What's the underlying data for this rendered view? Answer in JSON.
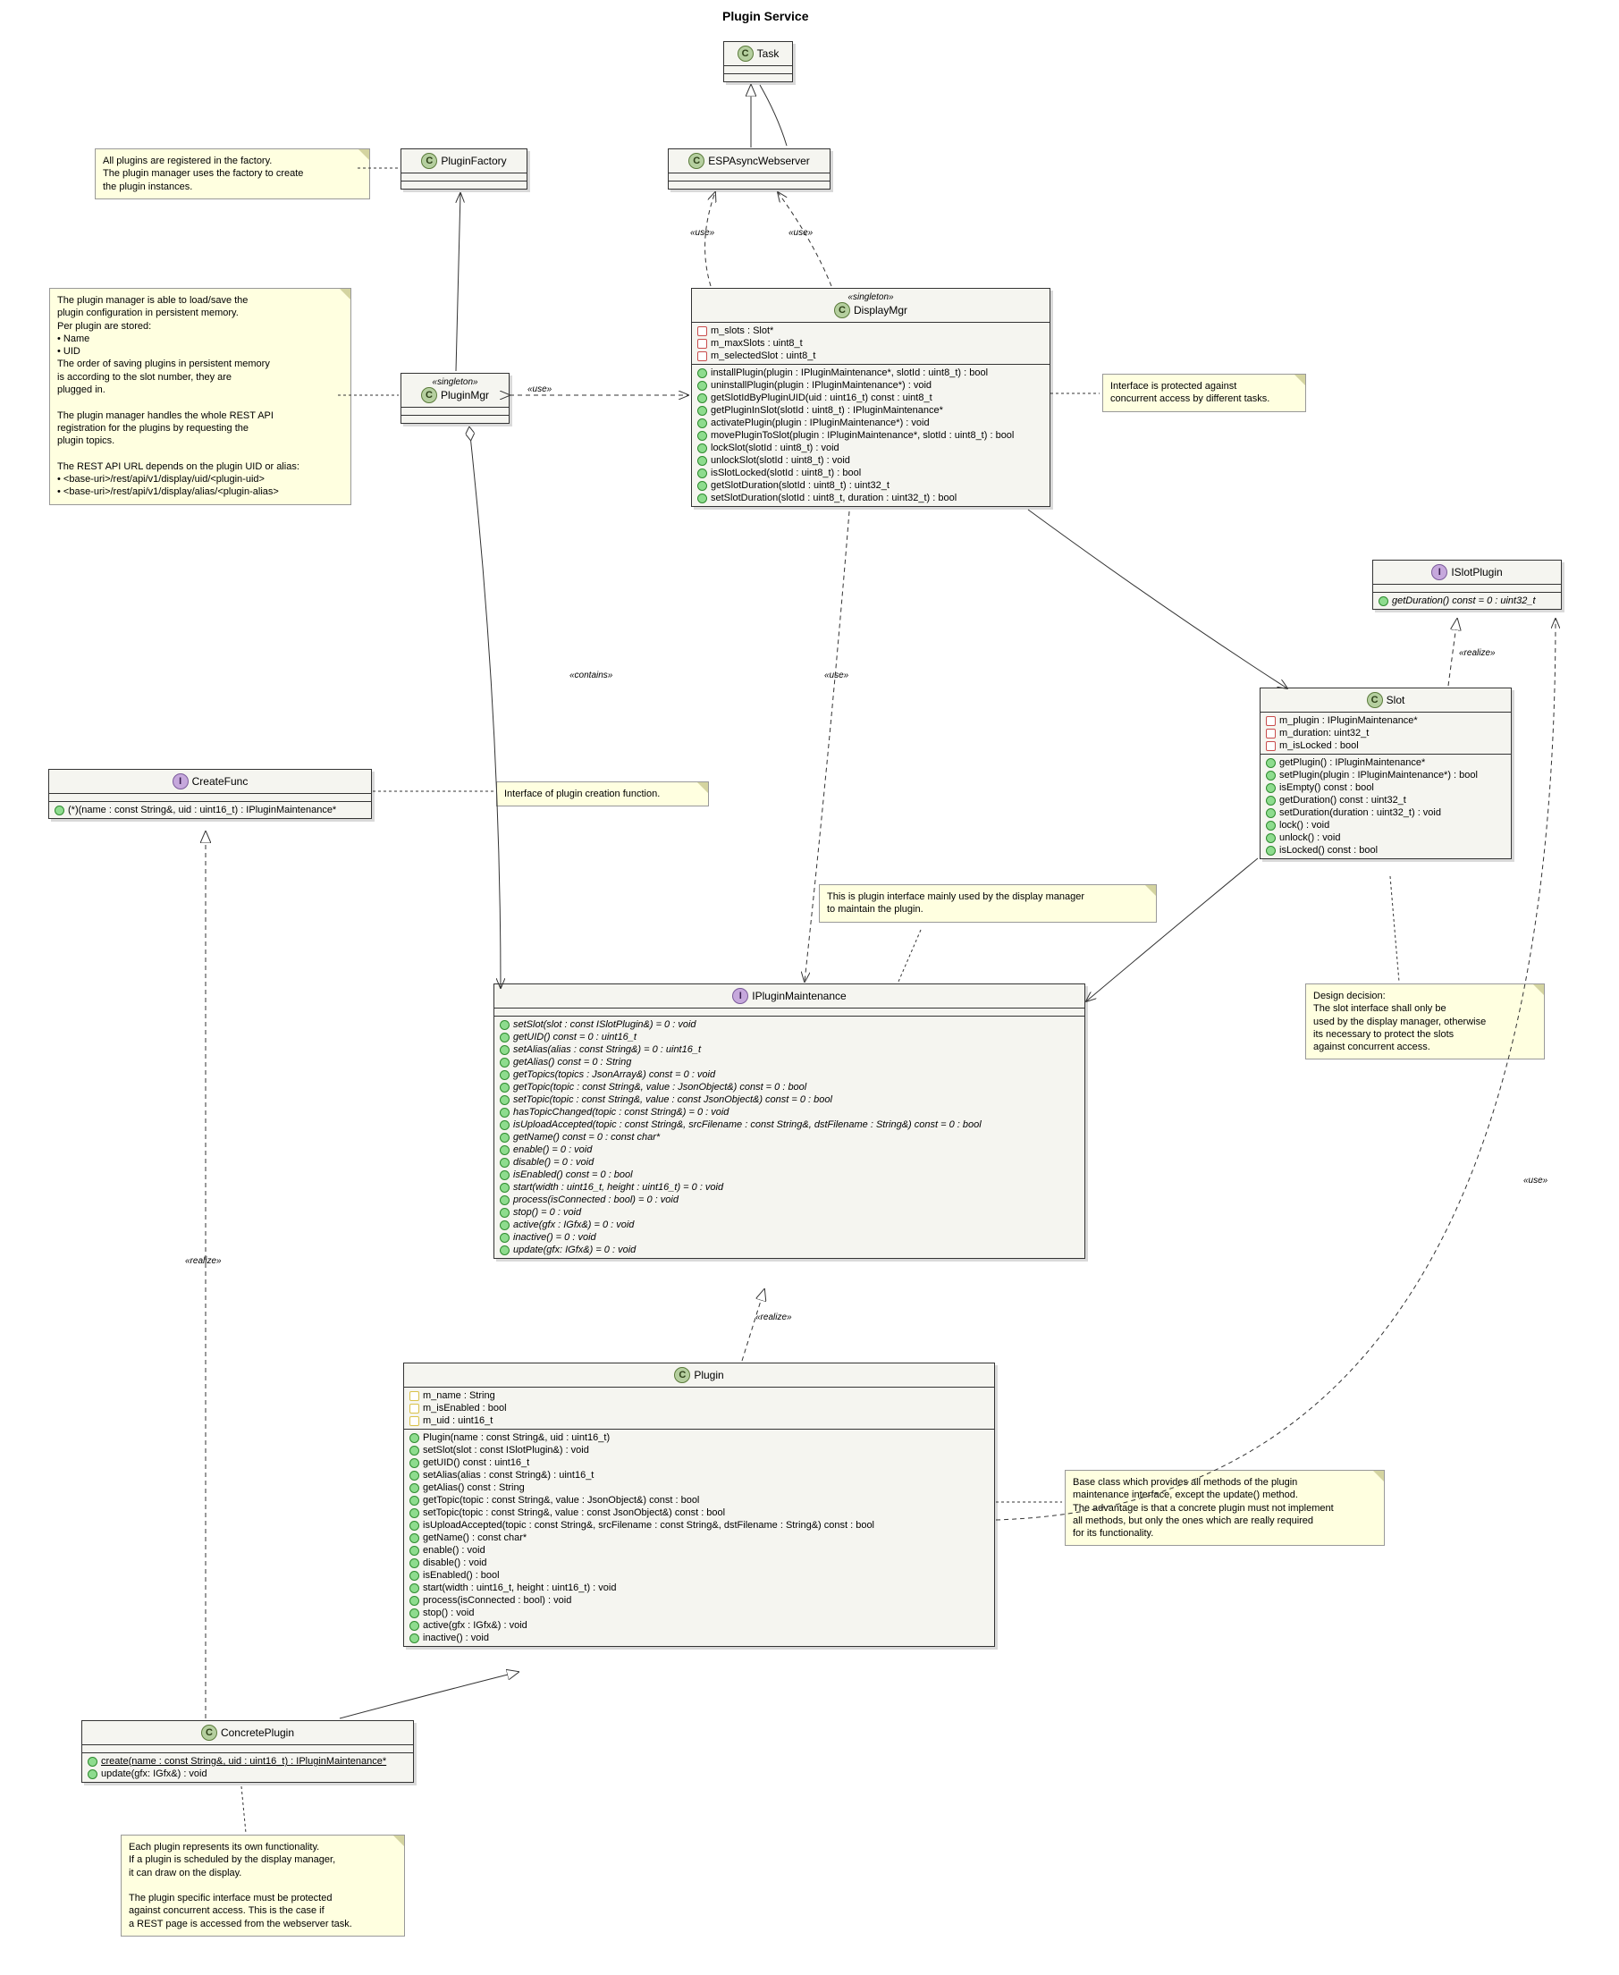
{
  "title": "Plugin Service",
  "classes": {
    "Task": {
      "name": "Task",
      "icon": "C"
    },
    "PluginFactory": {
      "name": "PluginFactory",
      "icon": "C"
    },
    "ESPAsyncWebserver": {
      "name": "ESPAsyncWebserver",
      "icon": "C"
    },
    "PluginMgr": {
      "name": "PluginMgr",
      "icon": "C",
      "stereotype": "«singleton»"
    },
    "DisplayMgr": {
      "name": "DisplayMgr",
      "icon": "C",
      "stereotype": "«singleton»",
      "attrs": [
        "m_slots : Slot*",
        "m_maxSlots : uint8_t",
        "m_selectedSlot : uint8_t"
      ],
      "ops": [
        "installPlugin(plugin : IPluginMaintenance*, slotId : uint8_t) : bool",
        "uninstallPlugin(plugin : IPluginMaintenance*) : void",
        "getSlotIdByPluginUID(uid : uint16_t) const : uint8_t",
        "getPluginInSlot(slotId : uint8_t) : IPluginMaintenance*",
        "activatePlugin(plugin : IPluginMaintenance*) : void",
        "movePluginToSlot(plugin : IPluginMaintenance*, slotId : uint8_t) : bool",
        "lockSlot(slotId : uint8_t) : void",
        "unlockSlot(slotId : uint8_t) : void",
        "isSlotLocked(slotId : uint8_t) : bool",
        "getSlotDuration(slotId : uint8_t) : uint32_t",
        "setSlotDuration(slotId : uint8_t, duration : uint32_t) : bool"
      ]
    },
    "ISlotPlugin": {
      "name": "ISlotPlugin",
      "icon": "I",
      "ops": [
        "getDuration() const = 0 : uint32_t"
      ]
    },
    "Slot": {
      "name": "Slot",
      "icon": "C",
      "attrs": [
        "m_plugin : IPluginMaintenance*",
        "m_duration: uint32_t",
        "m_isLocked : bool"
      ],
      "ops": [
        "getPlugin() : IPluginMaintenance*",
        "setPlugin(plugin : IPluginMaintenance*) : bool",
        "isEmpty() const : bool",
        "getDuration() const : uint32_t",
        "setDuration(duration : uint32_t) : void",
        "lock() : void",
        "unlock() : void",
        "isLocked() const : bool"
      ]
    },
    "CreateFunc": {
      "name": "CreateFunc",
      "icon": "I",
      "ops": [
        "(*)(name : const String&, uid : uint16_t) : IPluginMaintenance*"
      ]
    },
    "IPluginMaintenance": {
      "name": "IPluginMaintenance",
      "icon": "I",
      "ops": [
        "setSlot(slot : const ISlotPlugin&) = 0 : void",
        "getUID() const = 0 : uint16_t",
        "setAlias(alias : const String&) = 0 : uint16_t",
        "getAlias() const = 0 : String",
        "getTopics(topics : JsonArray&) const = 0 : void",
        "getTopic(topic : const String&, value : JsonObject&) const = 0 : bool",
        "setTopic(topic : const String&, value : const JsonObject&) const = 0 : bool",
        "hasTopicChanged(topic : const String&) = 0 : void",
        "isUploadAccepted(topic : const String&, srcFilename : const String&, dstFilename : String&) const = 0 : bool",
        "getName() const = 0 : const char*",
        "enable() = 0 : void",
        "disable() = 0 : void",
        "isEnabled() const = 0 : bool",
        "start(width : uint16_t, height : uint16_t) = 0 : void",
        "process(isConnected : bool) = 0 : void",
        "stop() = 0 : void",
        "active(gfx : IGfx&) = 0 : void",
        "inactive() = 0 : void",
        "update(gfx: IGfx&) = 0 : void"
      ]
    },
    "Plugin": {
      "name": "Plugin",
      "icon": "C",
      "attrs": [
        "m_name : String",
        "m_isEnabled : bool",
        "m_uid : uint16_t"
      ],
      "ops": [
        "Plugin(name : const String&, uid : uint16_t)",
        "setSlot(slot : const ISlotPlugin&) : void",
        "getUID() const : uint16_t",
        "setAlias(alias : const String&) : uint16_t",
        "getAlias() const : String",
        "getTopic(topic : const String&, value : JsonObject&) const : bool",
        "setTopic(topic : const String&, value : const JsonObject&) const : bool",
        "isUploadAccepted(topic : const String&, srcFilename : const String&, dstFilename : String&) const : bool",
        "getName() : const char*",
        "enable() : void",
        "disable() : void",
        "isEnabled() : bool",
        "start(width : uint16_t, height : uint16_t) : void",
        "process(isConnected : bool) : void",
        "stop() : void",
        "active(gfx : IGfx&) : void",
        "inactive() : void"
      ]
    },
    "ConcretePlugin": {
      "name": "ConcretePlugin",
      "icon": "C",
      "ops": [
        "create(name : const String&, uid : uint16_t) : IPluginMaintenance*",
        "update(gfx: IGfx&) : void"
      ]
    }
  },
  "notes": {
    "factory": "All plugins are registered in the factory.\nThe plugin manager uses the factory to create\nthe plugin instances.",
    "pluginmgr": "The plugin manager is able to load/save the\nplugin configuration in persistent memory.\nPer plugin are stored:\n• Name\n• UID\nThe order of saving plugins in persistent memory\nis according to the slot number, they are\nplugged in.\n\nThe plugin manager handles the whole REST API\nregistration for the plugins by requesting the\nplugin topics.\n\nThe REST API URL depends on the plugin UID or alias:\n• <base-uri>/rest/api/v1/display/uid/<plugin-uid>\n• <base-uri>/rest/api/v1/display/alias/<plugin-alias>",
    "displaymgr": "Interface is protected against\nconcurrent access by different tasks.",
    "createfunc": "Interface of plugin creation function.",
    "ipluginmaint": "This is plugin interface mainly used by the display manager\nto maintain the plugin.",
    "slot": "Design decision:\nThe slot interface shall only be\nused by the display manager, otherwise\nits necessary to protect the slots\nagainst concurrent access.",
    "plugin": "Base class which provides all methods of the plugin\nmaintenance interface, except the update() method.\nThe advantage is that a concrete plugin must not implement\nall methods, but only the ones which are really required\nfor its functionality.",
    "concrete": "Each plugin represents its own functionality.\nIf a plugin is scheduled by the display manager,\nit can draw on the display.\n\nThe plugin specific interface must be protected\nagainst concurrent access. This is the case if\na REST page is accessed from the webserver task."
  },
  "labels": {
    "use": "«use»",
    "contains": "«contains»",
    "realize": "«realize»"
  }
}
